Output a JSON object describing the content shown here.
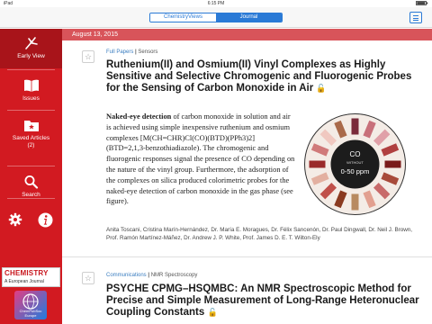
{
  "status_bar": {
    "carrier": "iPad",
    "time": "6:15 PM",
    "battery": ""
  },
  "top_bar": {
    "segments": [
      {
        "label": "ChemistryViews",
        "selected": false
      },
      {
        "label": "Journal",
        "selected": true
      }
    ],
    "menu_icon": "hamburger-icon"
  },
  "sidebar": {
    "items": [
      {
        "label": "Early View",
        "icon": "early-view-icon",
        "active": true
      },
      {
        "label": "Issues",
        "icon": "book-icon",
        "active": false
      },
      {
        "label": "Saved Articles\n(2)",
        "icon": "saved-folder-icon",
        "active": false
      },
      {
        "label": "Search",
        "icon": "search-icon",
        "active": false
      }
    ],
    "bottom_icons": [
      "gear-icon",
      "info-icon"
    ],
    "journal_logo": {
      "title": "CHEMISTRY",
      "subtitle": "A European Journal"
    },
    "partner_logo": {
      "text": "ChemPubSoc Europe"
    }
  },
  "date_bar": {
    "text": "August 13, 2015"
  },
  "articles": [
    {
      "type": "Full Papers",
      "section": "Sensors",
      "title": "Ruthenium(II) and Osmium(II) Vinyl Complexes as Highly Sensitive and Selective Chromogenic and Fluorogenic Probes for the Sensing of Carbon Monoxide in Air",
      "open_access": true,
      "abstract_lead": "Naked-eye detection",
      "abstract_body": " of carbon monoxide in solution and air is achieved using simple inexpensive ruthenium and osmium complexes [M(CH=CHR)Cl(CO)(BTD)(PPh3)2] (BTD=2,1,3-benzothiadiazole). The chromogenic and fluorogenic responses signal the presence of CO depending on the nature of the vinyl group. Furthermore, the adsorption of the complexes on silica produced colorimetric probes for the naked-eye detection of carbon monoxide in the gas phase (see figure).",
      "graphic": {
        "center_label": "CO",
        "sub_label": "WITHOUT",
        "range_label": "0-50 ppm"
      },
      "authors": "Anita Toscani, Cristina Marín-Hernández, Dr. María E. Moragues, Dr. Félix Sancenón, Dr. Paul Dingwall, Dr. Neil J. Brown, Prof. Ramón Martínez-Máñez, Dr. Andrew J. P. White, Prof. James D. E. T. Wilton-Ely"
    },
    {
      "type": "Communications",
      "section": "NMR Spectroscopy",
      "title": "PSYCHE CPMG–HSQMBC: An NMR Spectroscopic Method for Precise and Simple Measurement of Long-Range Heteronuclear Coupling Constants",
      "open_access": true
    }
  ],
  "colors": {
    "sidebar": "#d21a21",
    "sidebar_active": "#a8141a",
    "date_bar": "#d8545a",
    "accent_blue": "#2a7ad6",
    "open_access": "#f0a020"
  }
}
